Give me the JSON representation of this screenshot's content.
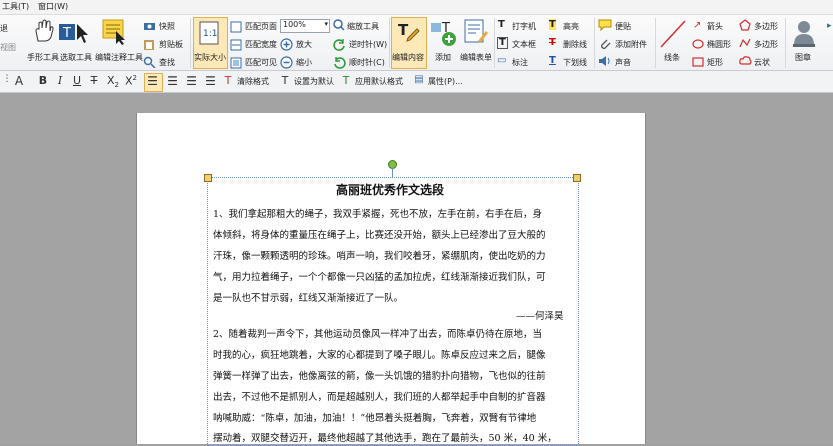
{
  "menu": [
    "工具(T)",
    "窗口(W)"
  ],
  "ribbon": {
    "left_partial": [
      "退",
      "视图"
    ],
    "hand_tool": "手形工具",
    "select_tool": "选取工具",
    "annot_tool": "编辑注释工具",
    "snapshot": "快照",
    "clipboard": "剪贴板",
    "find": "查找",
    "actual_size": "实际大小",
    "fit_page": "匹配页面",
    "fit_width": "匹配宽度",
    "fit_visible": "匹配可见",
    "zoom_value": "100%",
    "zoom_tool": "缩放工具",
    "zoom_in": "放大",
    "zoom_out": "缩小",
    "rotate_ccw": "逆时针(W)",
    "rotate_cw": "顺时针(C)",
    "edit_content": "编辑内容",
    "add": "添加",
    "edit_form": "编辑表单",
    "typewriter": "打字机",
    "textbox": "文本框",
    "callout": "标注",
    "highlight": "高亮",
    "strikeout": "删除线",
    "underline": "下划线",
    "note": "便贴",
    "attach": "添加附件",
    "sound": "声音",
    "line": "线条",
    "arrow": "箭头",
    "ellipse": "椭圆形",
    "rect": "矩形",
    "polygon": "多边形",
    "polyline": "多边形",
    "cloud": "云状",
    "stamp": "图章"
  },
  "format": {
    "clear_format": "清除格式",
    "set_default": "设置为默认",
    "apply_default": "应用默认格式",
    "properties": "属性(P)..."
  },
  "document": {
    "title": "高丽班优秀作文选段",
    "lines": [
      "1、我们拿起那粗大的绳子，我双手紧握，死也不放，左手在前，右手在后，身",
      "体倾斜，将身体的重量压在绳子上，比赛还没开始，额头上已经渗出了豆大般的",
      "汗珠，像一颗颗透明的珍珠。哨声一响，我们咬着牙，紧绷肌肉，使出吃奶的力",
      "气，用力拉着绳子，一个个都像一只凶猛的孟加拉虎，红线渐渐接近我们队，可",
      "是一队也不甘示弱，红线又渐渐接近了一队。"
    ],
    "author1": "——何泽昊",
    "lines2": [
      "2、随着裁判一声令下，其他运动员像风一样冲了出去，而陈卓仍待在原地，当",
      "时我的心，疯狂地跳着，大家的心都提到了嗓子眼儿。陈卓反应过来之后，腿像",
      "弹簧一样弹了出去，他像离弦的箭，像一头饥饿的猎豹扑向猎物，飞也似的往前",
      "出去，不过他不是抓别人，而是超越别人，我们班的人都举起手中自制的扩音器",
      "呐喊助威：“陈卓，加油，加油！！”他昂着头挺着胸，飞奔着，双臂有节律地",
      "摆动着，双腿交替迈开，最终他超越了其他选手，跑在了最前头，50 米，40 米，"
    ]
  }
}
